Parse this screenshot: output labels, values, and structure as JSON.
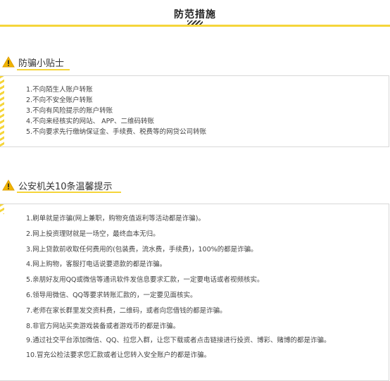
{
  "header": {
    "title": "防范措施"
  },
  "sections": [
    {
      "title": "防骗小贴士",
      "items": [
        "1.不向陌生人账户转账",
        "2.不向不安全账户转账",
        "3.不向有风险提示的账户转账",
        "4.不向来经核实的网站、 APP、二维码转账",
        "5.不向要求先行缴纳保证金、手续费、税费等的网贷公司转账"
      ]
    },
    {
      "title": "公安机关10条温馨提示",
      "items": [
        "1.刷单就是诈骗(网上兼职，购物充值返利等活动都是诈骗)。",
        "2.网上投资理财就是一场空，最终血本无归。",
        "3.网上贷款前收取任何费用的(包装费，流水费，手续费)，100%的都是诈骗。",
        "4.网上购物，客服打电话说要退款的都是诈骗。",
        "5.亲朋好友用QQ或微信等通讯软件发信息要求汇款，一定要电话或者视频核实。",
        "6.领导用微信、QQ等要求转账汇款的，一定要见面核实。",
        "7.老师在家长群里发交资料费，二维码，或者向您借钱的都是诈骗。",
        "8.非官方网站买卖游戏装备或者游戏币的都是诈骗。",
        "9.通过社交平台添加微信、QQ、拉您入群，让您下载或者点击链接进行投资、博彩、赌博的都是诈骗。",
        "10.冒充公检法要求您汇款或者让您转入安全账户的都是诈骗。"
      ]
    }
  ],
  "colors": {
    "accent": "#f5d53a",
    "warning_fill": "#f0b400",
    "text": "#444444"
  },
  "icons": [
    "warning-icon"
  ]
}
